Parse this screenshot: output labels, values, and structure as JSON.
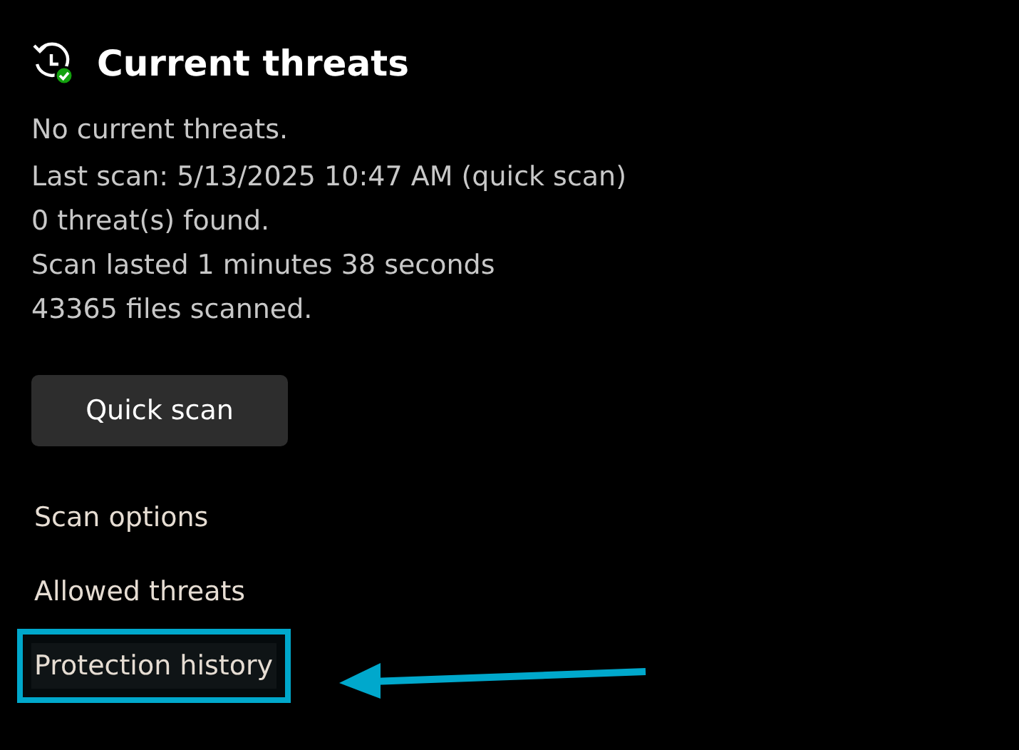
{
  "section": {
    "title": "Current threats"
  },
  "status_lines": [
    "No current threats.",
    "Last scan: 5/13/2025 10:47 AM (quick scan)",
    "0 threat(s) found.",
    "Scan lasted 1 minutes 38 seconds",
    "43365 files scanned."
  ],
  "button": {
    "label": "Quick scan"
  },
  "links": [
    {
      "label": "Scan options",
      "highlighted": false
    },
    {
      "label": "Allowed threats",
      "highlighted": false
    },
    {
      "label": "Protection history",
      "highlighted": true
    }
  ]
}
